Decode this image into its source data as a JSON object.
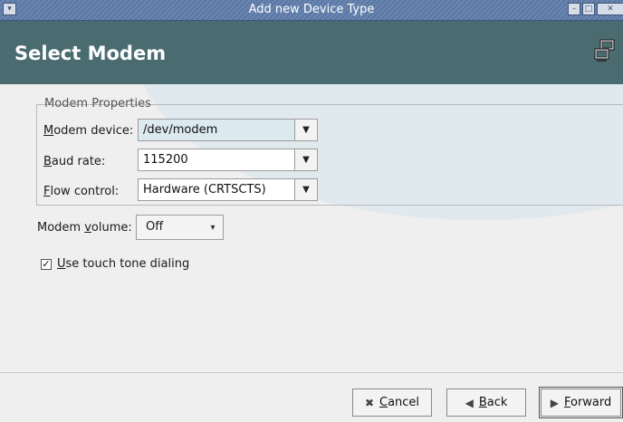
{
  "window": {
    "title": "Add new Device Type",
    "controls": [
      "minimize-icon",
      "maximize-icon",
      "close-icon"
    ]
  },
  "header": {
    "title": "Select Modem",
    "icon": "network-icon"
  },
  "modem_properties": {
    "frame_label": "Modem Properties",
    "device": {
      "label_prefix": "",
      "label_mn": "M",
      "label_rest": "odem device:",
      "value": "/dev/modem"
    },
    "baud": {
      "label_mn": "B",
      "label_rest": "aud rate:",
      "value": "115200"
    },
    "flow": {
      "label_mn": "F",
      "label_rest": "low control:",
      "value": "Hardware (CRTSCTS)"
    }
  },
  "volume": {
    "label_pre": "Modem ",
    "label_mn": "v",
    "label_rest": "olume:",
    "value": "Off"
  },
  "touch_tone": {
    "checked": true,
    "label_mn": "U",
    "label_rest": "se touch tone dialing"
  },
  "buttons": {
    "cancel": {
      "mn": "C",
      "rest": "ancel"
    },
    "back": {
      "mn": "B",
      "rest": "ack"
    },
    "forward": {
      "mn": "F",
      "rest": "orward"
    }
  }
}
